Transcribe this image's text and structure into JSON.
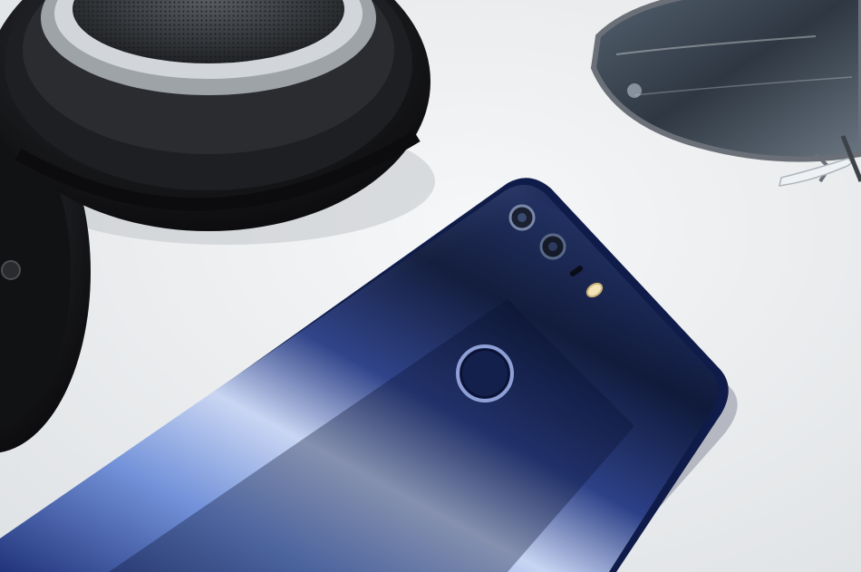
{
  "scene": {
    "description_colors": {
      "surface": "#eef0f2",
      "phone_body_dark": "#0e1a3e",
      "phone_body_mid": "#2b3f86",
      "phone_highlight": "#c9d6f2",
      "headphone_dark": "#1a1b1d",
      "headphone_metal": "#b8bcc0",
      "lens_tint": "#3a4654",
      "frame_metal": "#6b7078"
    },
    "objects": [
      {
        "id": "phone",
        "icon": "smartphone-back-icon"
      },
      {
        "id": "headphones",
        "icon": "headphones-icon"
      },
      {
        "id": "sunglasses",
        "icon": "sunglasses-icon"
      }
    ]
  }
}
